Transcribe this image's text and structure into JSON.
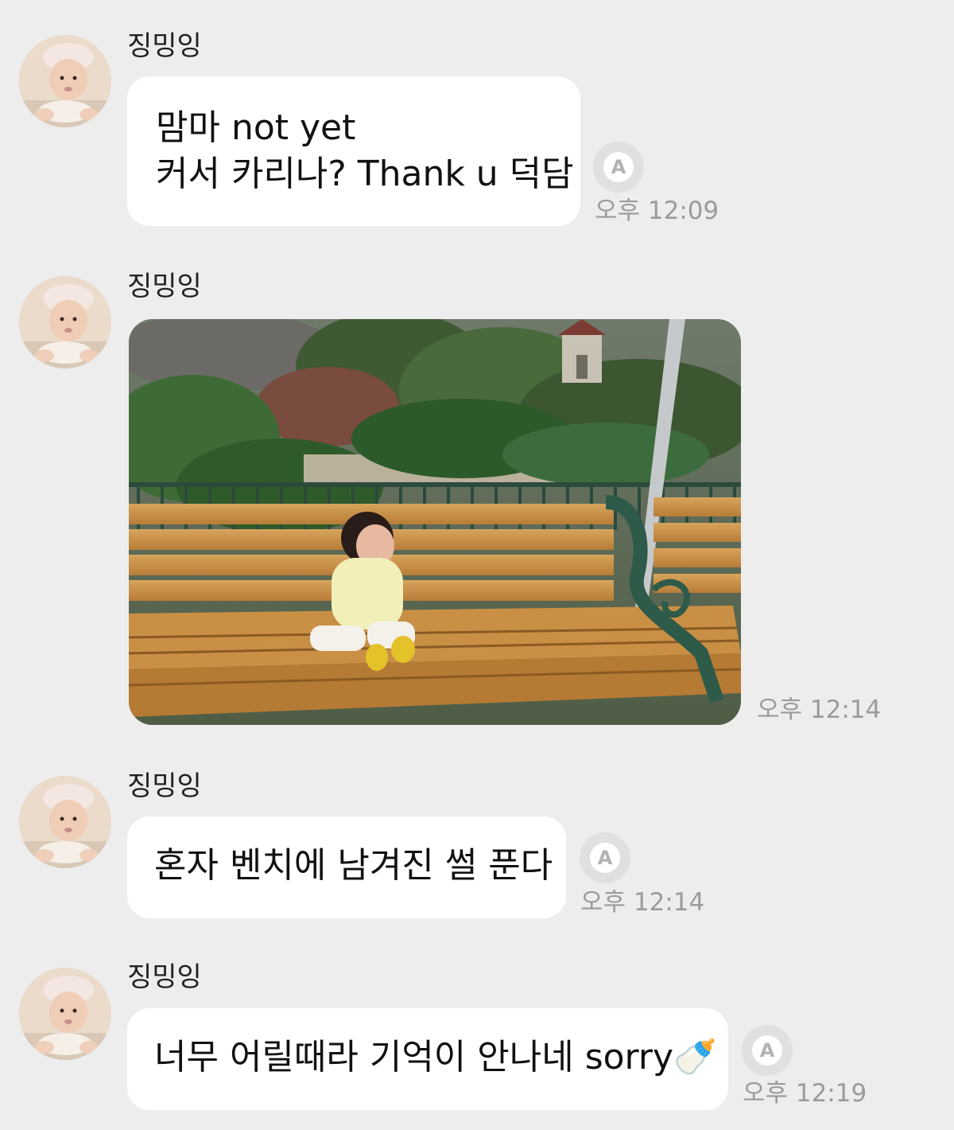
{
  "messages": [
    {
      "sender": "징밍잉",
      "text": "맘마 not yet\n커서 카리나? Thank u 덕담",
      "time": "오후 12:09",
      "translate_icon": "translate-icon"
    },
    {
      "sender": "징밍잉",
      "photo": "baby-on-bench-photo",
      "time": "오후 12:14"
    },
    {
      "sender": "징밍잉",
      "text": "혼자 벤치에 남겨진 썰 푼다",
      "time": "오후 12:14",
      "translate_icon": "translate-icon"
    },
    {
      "sender": "징밍잉",
      "text": "너무 어릴때라 기억이 안나네 sorry🍼",
      "time": "오후 12:19",
      "translate_icon": "translate-icon"
    }
  ],
  "translate_label": "A"
}
